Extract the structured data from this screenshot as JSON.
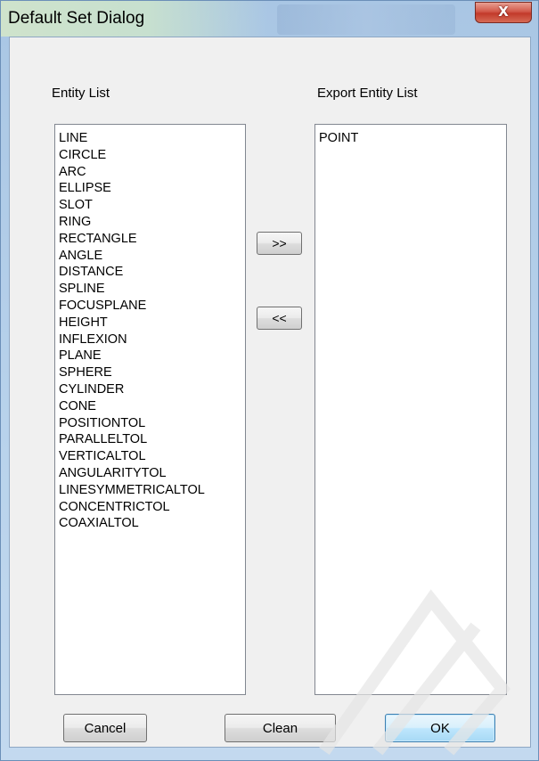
{
  "window": {
    "title": "Default Set Dialog",
    "close_label": "X"
  },
  "entity_list": {
    "label": "Entity List",
    "items": [
      "LINE",
      "CIRCLE",
      "ARC",
      "ELLIPSE",
      "SLOT",
      "RING",
      "RECTANGLE",
      "ANGLE",
      "DISTANCE",
      "SPLINE",
      "FOCUSPLANE",
      "HEIGHT",
      "INFLEXION",
      "PLANE",
      "SPHERE",
      "CYLINDER",
      "CONE",
      "POSITIONTOL",
      "PARALLELTOL",
      "VERTICALTOL",
      "ANGULARITYTOL",
      "LINESYMMETRICALTOL",
      "CONCENTRICTOL",
      "COAXIALTOL"
    ]
  },
  "export_list": {
    "label": "Export Entity List",
    "items": [
      "POINT"
    ]
  },
  "buttons": {
    "add": ">>",
    "remove": "<<",
    "cancel": "Cancel",
    "clean": "Clean",
    "ok": "OK"
  }
}
